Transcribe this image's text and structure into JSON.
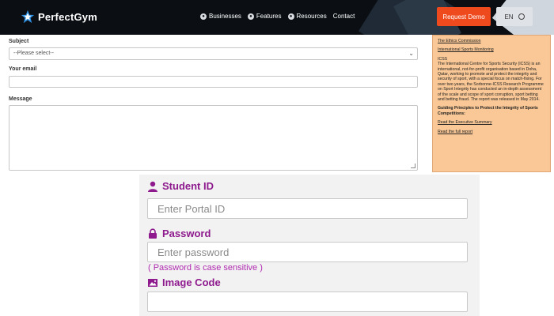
{
  "header": {
    "brand": "PerfectGym",
    "nav": [
      {
        "label": "Businesses",
        "icon": "globe-icon"
      },
      {
        "label": "Features",
        "icon": "globe-icon"
      },
      {
        "label": "Resources",
        "icon": "globe-icon"
      },
      {
        "label": "Contact"
      }
    ],
    "demo_label": "Request Demo",
    "lang_label": "EN",
    "colors": {
      "bg": "#0b0f14",
      "accent": "#ef4a1e"
    }
  },
  "form": {
    "subject_label": "Subject",
    "subject_value": "--Please select--",
    "email_label": "Your email",
    "message_label": "Message"
  },
  "sidebar": {
    "link1": "The Ethics Commission",
    "link2": "International Sports Monitoring",
    "icss_head": "ICSS",
    "icss_body": "The International Centre for Sports Security (ICSS) is an international, not-for-profit organisation based in Doha, Qatar, working to promote and protect the integrity and security of sport, with a special focus on match-fixing. For over two years, the Sorbonne-ICSS Research Programme on Sport Integrity has conducted an in-depth assessment of the scale and scope of sport corruption, sport betting and betting fraud. The report was released in May 2014.",
    "guiding": "Guiding Principles to Protect the Integrity of Sports Competitions:",
    "read_summary": "Read the Executive Summary",
    "read_full": "Read the full report",
    "bg": "#f9c896"
  },
  "login": {
    "student_id_label": "Student ID",
    "student_id_placeholder": "Enter Portal ID",
    "password_label": "Password",
    "password_placeholder": "Enter password",
    "password_hint": "( Password is case sensitive )",
    "image_code_label": "Image Code",
    "accent": "#8e1a8e"
  }
}
